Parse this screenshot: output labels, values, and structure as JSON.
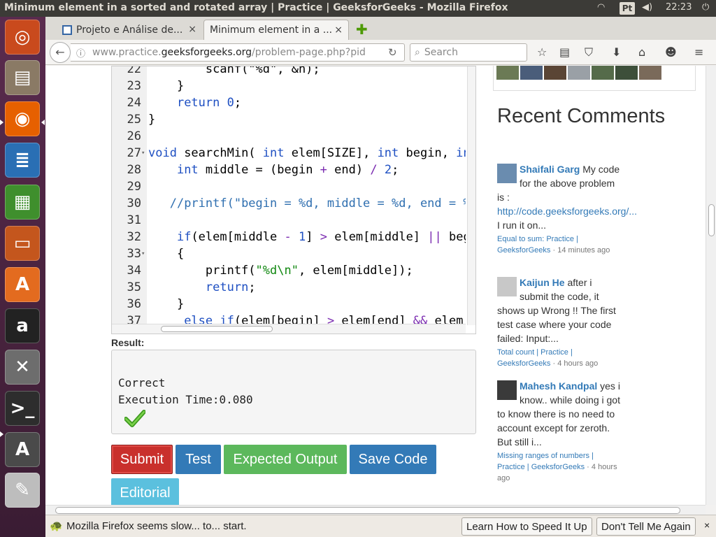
{
  "panel": {
    "window_title": "Minimum element in a sorted and rotated array | Practice | GeeksforGeeks - Mozilla Firefox",
    "keyboard": "Pt",
    "clock": "22:23"
  },
  "launcher": {
    "items": [
      {
        "name": "ubuntu-dash-icon",
        "glyph": "◎",
        "color": "#c94a1d"
      },
      {
        "name": "files-icon",
        "glyph": "▤",
        "color": "#8a7a65"
      },
      {
        "name": "firefox-icon",
        "glyph": "◉",
        "color": "#e66000"
      },
      {
        "name": "writer-icon",
        "glyph": "≣",
        "color": "#2a6fb4"
      },
      {
        "name": "calc-icon",
        "glyph": "▦",
        "color": "#3f8f2d"
      },
      {
        "name": "impress-icon",
        "glyph": "▭",
        "color": "#c4561d"
      },
      {
        "name": "software-center-icon",
        "glyph": "A",
        "color": "#e36b1f"
      },
      {
        "name": "amazon-icon",
        "glyph": "a",
        "color": "#222222"
      },
      {
        "name": "system-settings-icon",
        "glyph": "✕",
        "color": "#6d6d6d"
      },
      {
        "name": "terminal-icon",
        "glyph": ">_",
        "color": "#2d2d2d"
      },
      {
        "name": "software-updater-icon",
        "glyph": "A",
        "color": "#4a4a4a"
      },
      {
        "name": "text-editor-icon",
        "glyph": "✎",
        "color": "#bdbdbd"
      }
    ]
  },
  "tabs": [
    {
      "label": "Projeto e Análise de...",
      "close": "×"
    },
    {
      "label": "Minimum element in a ...",
      "close": "×"
    }
  ],
  "newtab": "✚",
  "nav": {
    "url_prefix": "www.practice.",
    "url_domain": "geeksforgeeks.org",
    "url_suffix": "/problem-page.php?pid",
    "search_placeholder": "Search"
  },
  "editor": {
    "lines": [
      {
        "n": "22",
        "fold": "",
        "html": "        <span class='code'>scanf(\"%d\", &amp;n);</span>"
      },
      {
        "n": "23",
        "fold": "",
        "html": "    }"
      },
      {
        "n": "24",
        "fold": "",
        "html": "    <span class='kw'>return</span> <span class='num'>0</span>;"
      },
      {
        "n": "25",
        "fold": "",
        "html": "}"
      },
      {
        "n": "26",
        "fold": "",
        "html": ""
      },
      {
        "n": "27",
        "fold": "▾",
        "html": "<span class='kw'>void</span> searchMin( <span class='kw'>int</span> elem[SIZE], <span class='kw'>int</span> begin, <span class='kw'>in</span>"
      },
      {
        "n": "28",
        "fold": "",
        "html": "    <span class='kw'>int</span> middle = (begin <span class='op'>+</span> end) <span class='op'>/</span> <span class='num'>2</span>;"
      },
      {
        "n": "29",
        "fold": "",
        "html": ""
      },
      {
        "n": "30",
        "fold": "",
        "html": "   <span class='cmt'>//printf(\"begin = %d, middle = %d, end = %</span>"
      },
      {
        "n": "31",
        "fold": "",
        "html": ""
      },
      {
        "n": "32",
        "fold": "",
        "html": "    <span class='kw'>if</span>(elem[middle <span class='op'>-</span> <span class='num'>1</span>] <span class='op'>&gt;</span> elem[middle] <span class='op'>||</span> beg"
      },
      {
        "n": "33",
        "fold": "▾",
        "html": "    {"
      },
      {
        "n": "34",
        "fold": "",
        "html": "        printf(<span class='str'>\"%d\\n\"</span>, elem[middle]);"
      },
      {
        "n": "35",
        "fold": "",
        "html": "        <span class='kw'>return</span>;"
      },
      {
        "n": "36",
        "fold": "",
        "html": "    }"
      },
      {
        "n": "37",
        "fold": "",
        "html": "     <span class='kw'>else</span> <span class='kw'>if</span>(elem[begin] <span class='op'>&gt;</span> elem[end] <span class='op'>&amp;&amp;</span> elem["
      }
    ]
  },
  "result": {
    "label": "Result:",
    "line1": "Correct",
    "line2": "Execution Time:0.080"
  },
  "buttons": {
    "submit": "Submit",
    "test": "Test",
    "expected": "Expected Output",
    "save": "Save Code",
    "editorial": "Editorial"
  },
  "sidebar": {
    "title": "Recent Comments",
    "comments": [
      {
        "author": "Shaifali Garg",
        "text1": " My code for the above problem is : ",
        "link": "http://code.geeksforgeeks.org/...",
        "text2": " I run it on...",
        "meta": "Equal to sum: Practice | GeeksforGeeks",
        "time": " · 14 minutes ago"
      },
      {
        "author": "Kaijun He",
        "text1": " after i submit the code, it shows up Wrong !! The first test case where your code failed: Input:...",
        "link": "",
        "text2": "",
        "meta": "Total count | Practice | GeeksforGeeks",
        "time": " · 4 hours ago"
      },
      {
        "author": "Mahesh Kandpal",
        "text1": " yes i know.. while doing i got to know there is no need to account except for zeroth. But still i...",
        "link": "",
        "text2": "",
        "meta": "Missing ranges of numbers | Practice | GeeksforGeeks",
        "time": " · 4 hours ago"
      }
    ]
  },
  "notification": {
    "message": "Mozilla Firefox seems slow... to... start.",
    "learn": "Learn How to Speed It Up",
    "dont": "Don't Tell Me Again",
    "close": "×"
  }
}
